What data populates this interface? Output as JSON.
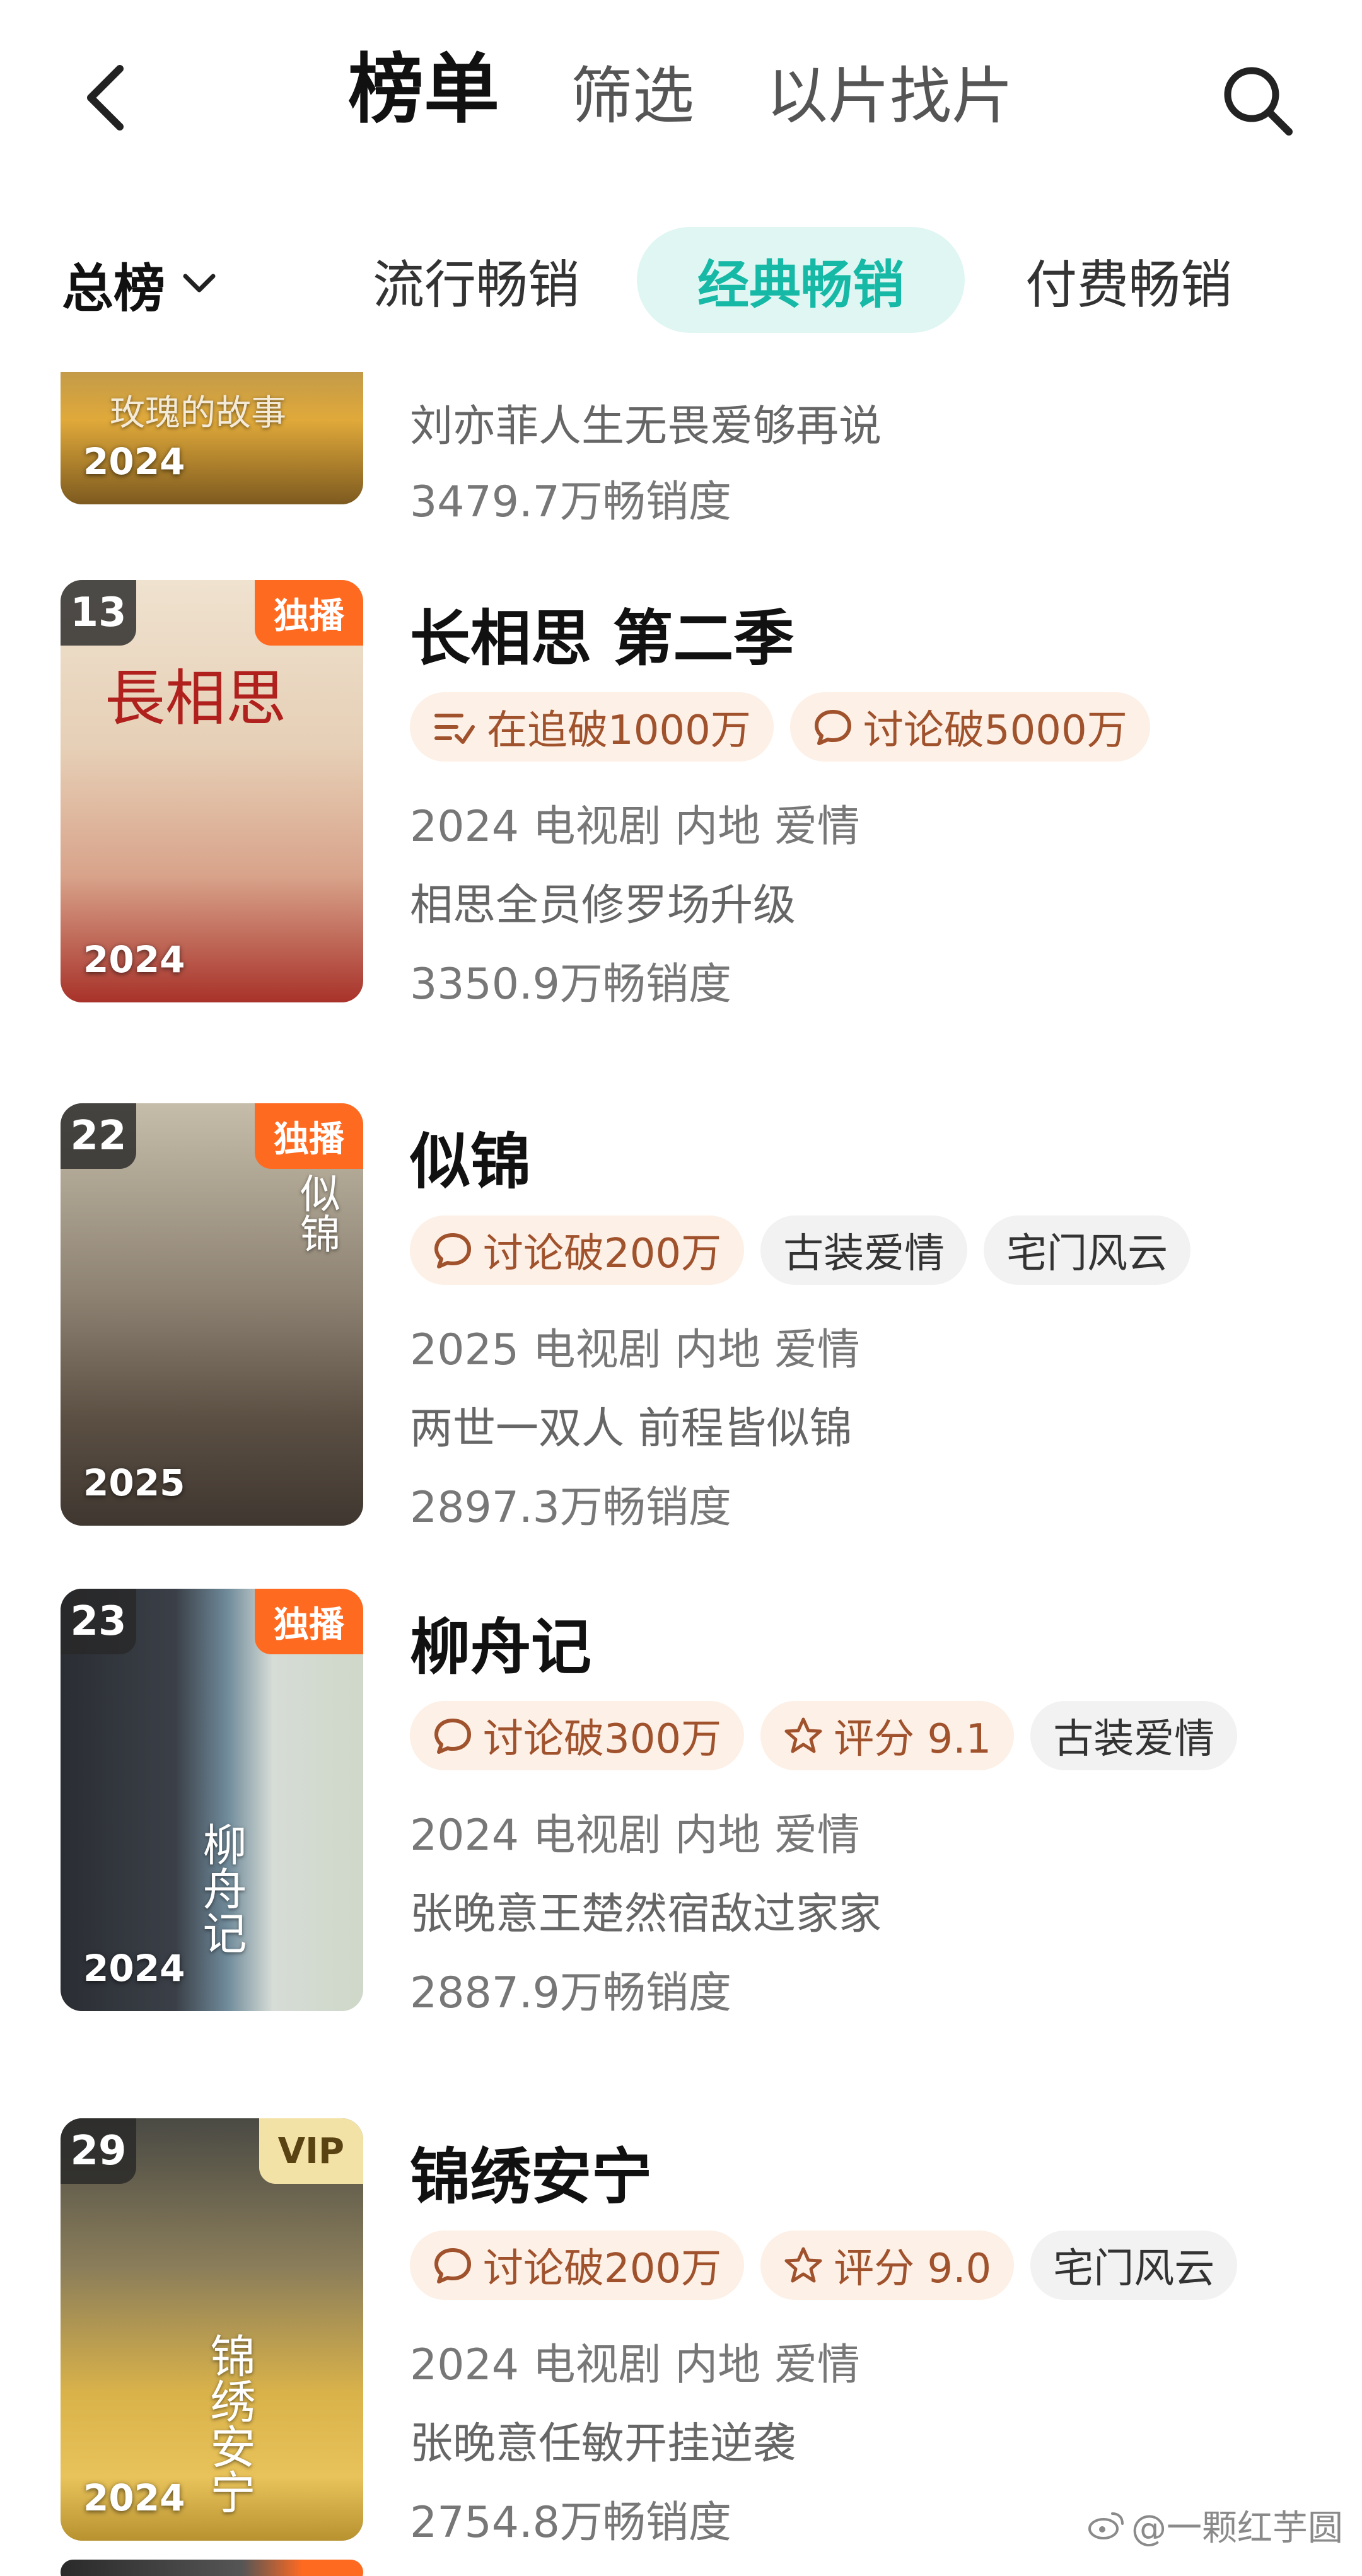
{
  "nav": {
    "back_icon": "back-arrow-icon",
    "tabs": [
      {
        "label": "榜单",
        "active": true
      },
      {
        "label": "筛选",
        "active": false
      },
      {
        "label": "以片找片",
        "active": false
      }
    ],
    "search_icon": "search-icon"
  },
  "subnav": {
    "dropdown_label": "总榜",
    "dropdown_icon": "chevron-down-icon",
    "tabs": [
      {
        "label": "流行畅销",
        "active": false
      },
      {
        "label": "经典畅销",
        "active": true
      },
      {
        "label": "付费畅销",
        "active": false
      }
    ]
  },
  "items": [
    {
      "poster_title": "玫瑰的故事",
      "poster_year": "2024",
      "desc": "刘亦菲人生无畏爱够再说",
      "sales": "3479.7万畅销度"
    },
    {
      "rank": "13",
      "badge": "独播",
      "poster_title": "長相思",
      "poster_year": "2024",
      "title": "长相思 第二季",
      "tags": [
        {
          "icon": "list-icon",
          "text": "在追破1000万"
        },
        {
          "icon": "comment-icon",
          "text": "讨论破5000万"
        }
      ],
      "info": "2024 电视剧 内地 爱情",
      "desc": "相思全员修罗场升级",
      "sales": "3350.9万畅销度"
    },
    {
      "rank": "22",
      "badge": "独播",
      "poster_title": "似锦",
      "poster_year": "2025",
      "title": "似锦",
      "tags": [
        {
          "icon": "comment-icon",
          "text": "讨论破200万"
        },
        {
          "text": "古装爱情"
        },
        {
          "text": "宅门风云"
        }
      ],
      "info": "2025 电视剧 内地 爱情",
      "desc": "两世一双人 前程皆似锦",
      "sales": "2897.3万畅销度"
    },
    {
      "rank": "23",
      "badge": "独播",
      "poster_title": "柳舟记",
      "poster_year": "2024",
      "title": "柳舟记",
      "tags": [
        {
          "icon": "comment-icon",
          "text": "讨论破300万"
        },
        {
          "icon": "star-icon",
          "text": "评分 9.1"
        },
        {
          "text": "古装爱情"
        }
      ],
      "info": "2024 电视剧 内地 爱情",
      "desc": "张晚意王楚然宿敌过家家",
      "sales": "2887.9万畅销度"
    },
    {
      "rank": "29",
      "badge": "VIP",
      "poster_title": "锦绣安宁",
      "poster_year": "2024",
      "title": "锦绣安宁",
      "tags": [
        {
          "icon": "comment-icon",
          "text": "讨论破200万"
        },
        {
          "icon": "star-icon",
          "text": "评分 9.0"
        },
        {
          "text": "宅门风云"
        }
      ],
      "info": "2024 电视剧 内地 爱情",
      "desc": "张晚意任敏开挂逆袭",
      "sales": "2754.8万畅销度"
    }
  ],
  "watermark": "@一颗红芋圆",
  "colors": {
    "accent": "#16b8a6",
    "accent_bg": "#dff6f3",
    "exclusive_badge": "#ff6a21",
    "vip_badge": "#f3e2a6",
    "hot_tag_bg": "#fdf0e6"
  }
}
